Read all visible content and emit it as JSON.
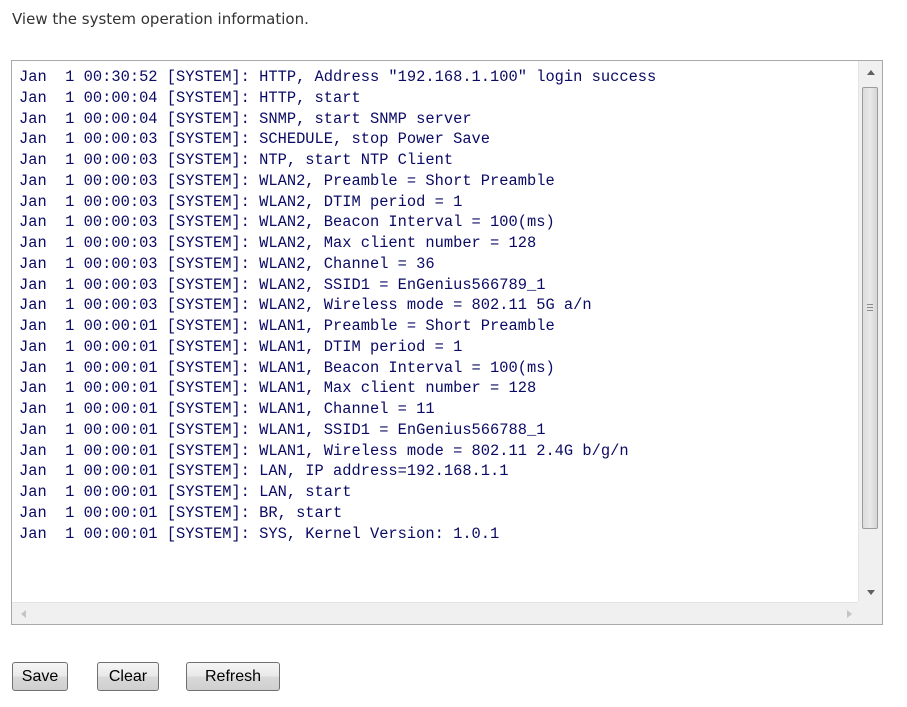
{
  "intro_text": "View the system operation information.",
  "log_lines": [
    "Jan  1 00:30:52 [SYSTEM]: HTTP, Address \"192.168.1.100\" login success",
    "Jan  1 00:00:04 [SYSTEM]: HTTP, start",
    "Jan  1 00:00:04 [SYSTEM]: SNMP, start SNMP server",
    "Jan  1 00:00:03 [SYSTEM]: SCHEDULE, stop Power Save",
    "Jan  1 00:00:03 [SYSTEM]: NTP, start NTP Client",
    "Jan  1 00:00:03 [SYSTEM]: WLAN2, Preamble = Short Preamble",
    "Jan  1 00:00:03 [SYSTEM]: WLAN2, DTIM period = 1",
    "Jan  1 00:00:03 [SYSTEM]: WLAN2, Beacon Interval = 100(ms)",
    "Jan  1 00:00:03 [SYSTEM]: WLAN2, Max client number = 128",
    "Jan  1 00:00:03 [SYSTEM]: WLAN2, Channel = 36",
    "Jan  1 00:00:03 [SYSTEM]: WLAN2, SSID1 = EnGenius566789_1",
    "Jan  1 00:00:03 [SYSTEM]: WLAN2, Wireless mode = 802.11 5G a/n",
    "Jan  1 00:00:01 [SYSTEM]: WLAN1, Preamble = Short Preamble",
    "Jan  1 00:00:01 [SYSTEM]: WLAN1, DTIM period = 1",
    "Jan  1 00:00:01 [SYSTEM]: WLAN1, Beacon Interval = 100(ms)",
    "Jan  1 00:00:01 [SYSTEM]: WLAN1, Max client number = 128",
    "Jan  1 00:00:01 [SYSTEM]: WLAN1, Channel = 11",
    "Jan  1 00:00:01 [SYSTEM]: WLAN1, SSID1 = EnGenius566788_1",
    "Jan  1 00:00:01 [SYSTEM]: WLAN1, Wireless mode = 802.11 2.4G b/g/n",
    "Jan  1 00:00:01 [SYSTEM]: LAN, IP address=192.168.1.1",
    "Jan  1 00:00:01 [SYSTEM]: LAN, start",
    "Jan  1 00:00:01 [SYSTEM]: BR, start",
    "Jan  1 00:00:01 [SYSTEM]: SYS, Kernel Version: 1.0.1"
  ],
  "buttons": {
    "save_label": "Save",
    "clear_label": "Clear",
    "refresh_label": "Refresh"
  },
  "colors": {
    "log_text": "#0a0a64",
    "button_border": "#707070"
  }
}
